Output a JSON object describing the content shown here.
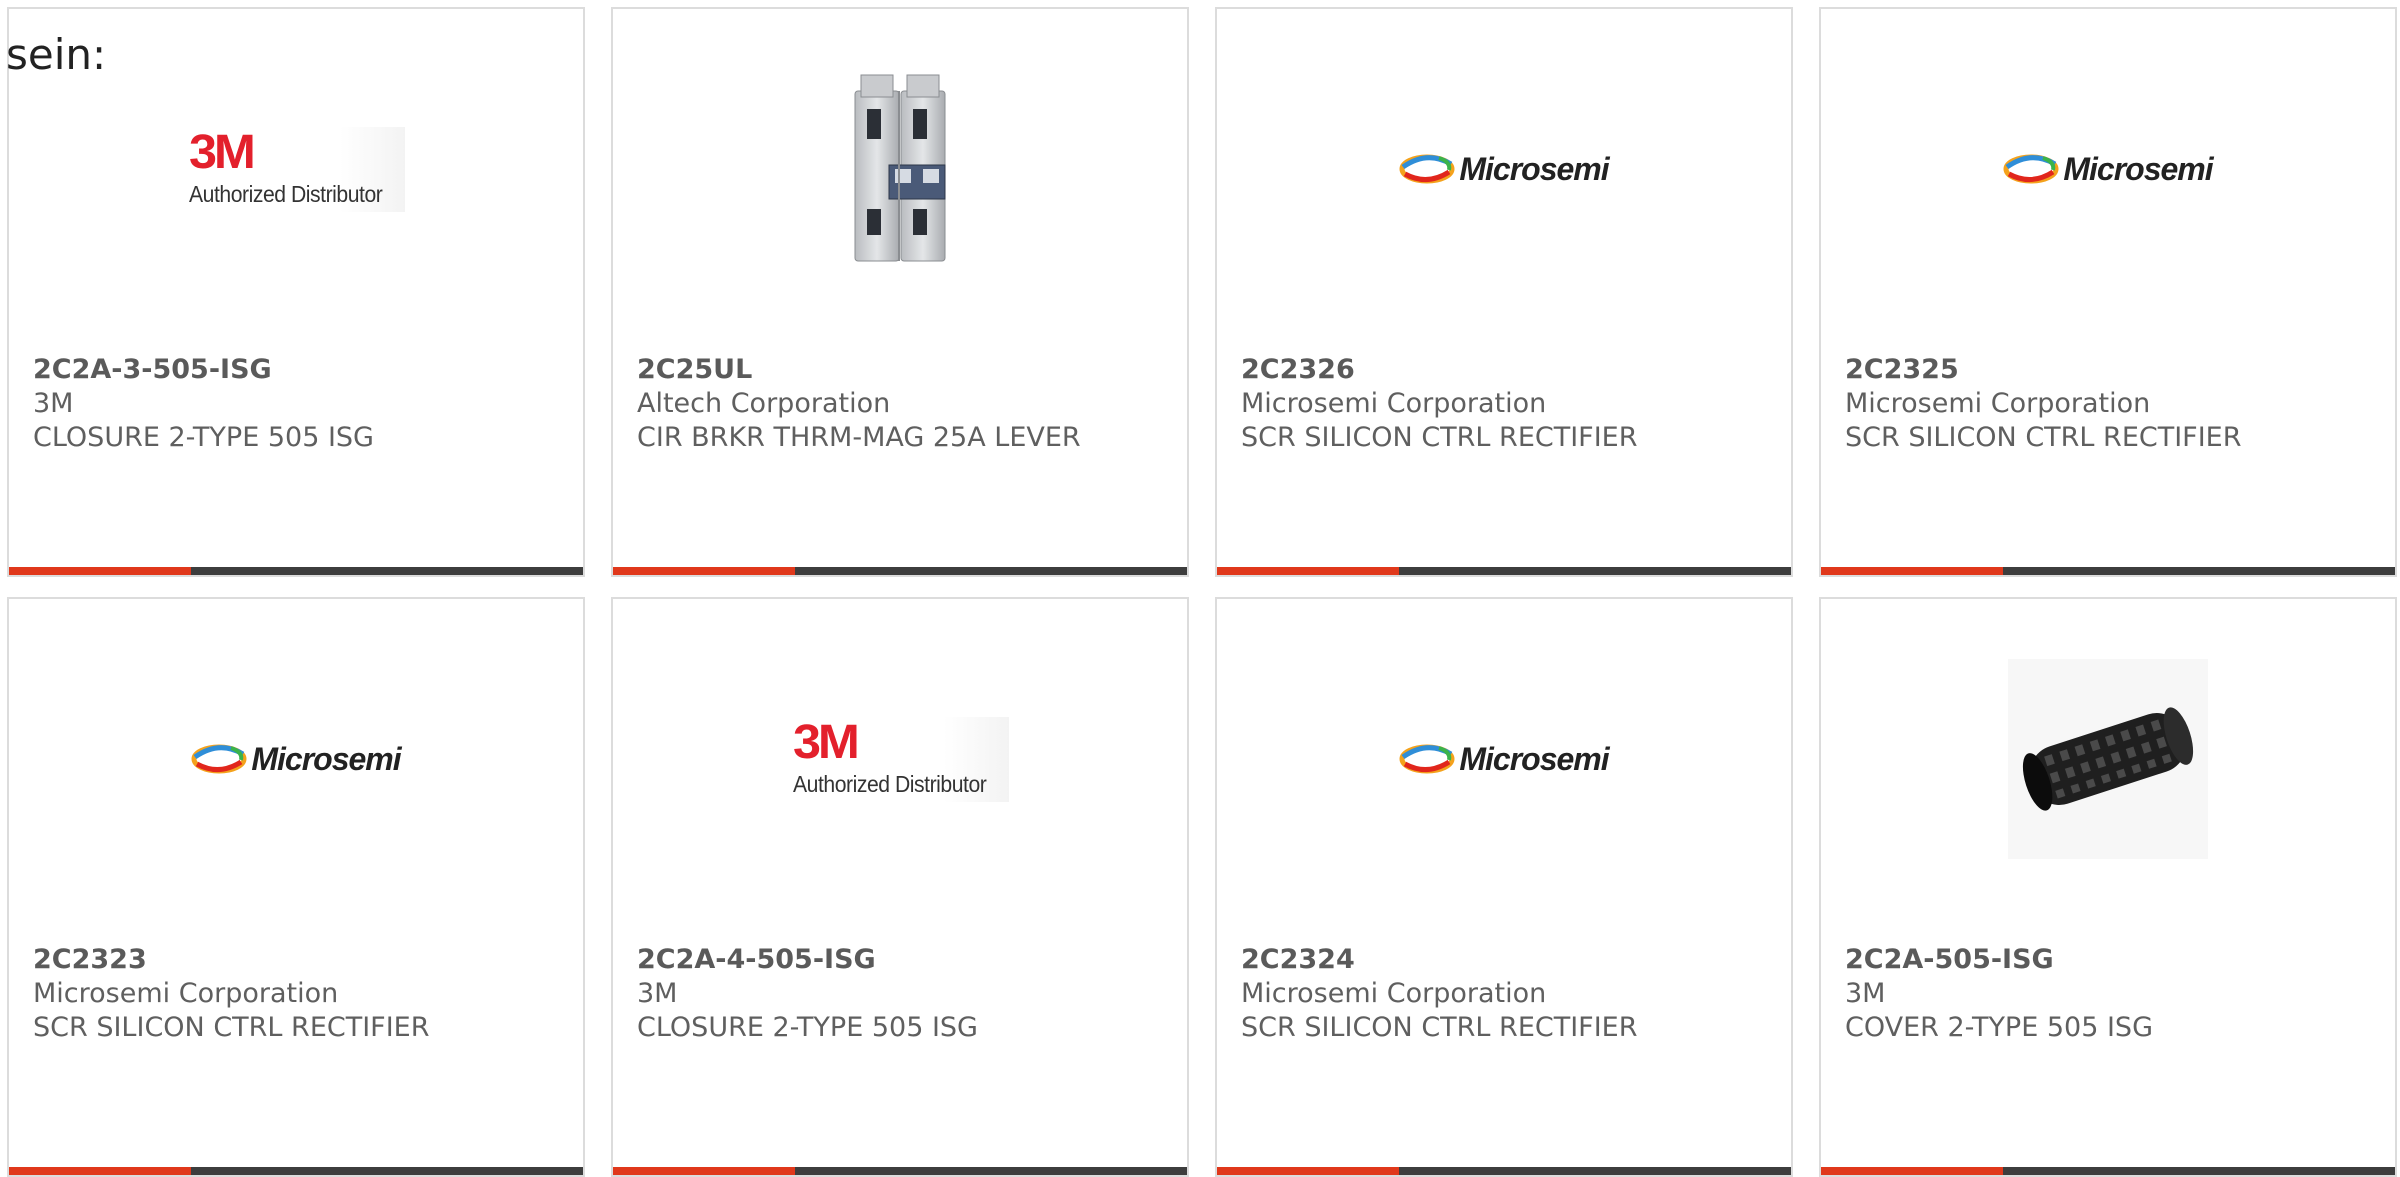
{
  "intro_text": "sein:",
  "colors": {
    "accent": "#e0381b",
    "bar": "#3d3d3d",
    "card_border": "#dcdcdc",
    "text": "#5f5f5f",
    "brand_3m_red": "#e3202c"
  },
  "products": [
    {
      "part_number": "2C2A-3-505-ISG",
      "manufacturer": "3M",
      "description": "CLOSURE 2-TYPE 505 ISG",
      "image": {
        "type": "logo-3m",
        "mark": "3M",
        "tagline": "Authorized Distributor"
      }
    },
    {
      "part_number": "2C25UL",
      "manufacturer": "Altech Corporation",
      "description": "CIR BRKR THRM-MAG 25A LEVER",
      "image": {
        "type": "circuit-breaker-photo"
      }
    },
    {
      "part_number": "2C2326",
      "manufacturer": "Microsemi Corporation",
      "description": "SCR SILICON CTRL RECTIFIER",
      "image": {
        "type": "logo-microsemi",
        "wordmark": "Microsemi"
      }
    },
    {
      "part_number": "2C2325",
      "manufacturer": "Microsemi Corporation",
      "description": "SCR SILICON CTRL RECTIFIER",
      "image": {
        "type": "logo-microsemi",
        "wordmark": "Microsemi"
      }
    },
    {
      "part_number": "2C2323",
      "manufacturer": "Microsemi Corporation",
      "description": "SCR SILICON CTRL RECTIFIER",
      "image": {
        "type": "logo-microsemi",
        "wordmark": "Microsemi"
      }
    },
    {
      "part_number": "2C2A-4-505-ISG",
      "manufacturer": "3M",
      "description": "CLOSURE 2-TYPE 505 ISG",
      "image": {
        "type": "logo-3m",
        "mark": "3M",
        "tagline": "Authorized Distributor"
      }
    },
    {
      "part_number": "2C2324",
      "manufacturer": "Microsemi Corporation",
      "description": "SCR SILICON CTRL RECTIFIER",
      "image": {
        "type": "logo-microsemi",
        "wordmark": "Microsemi"
      }
    },
    {
      "part_number": "2C2A-505-ISG",
      "manufacturer": "3M",
      "description": "COVER 2-TYPE 505 ISG",
      "image": {
        "type": "cable-cover-photo"
      }
    }
  ]
}
